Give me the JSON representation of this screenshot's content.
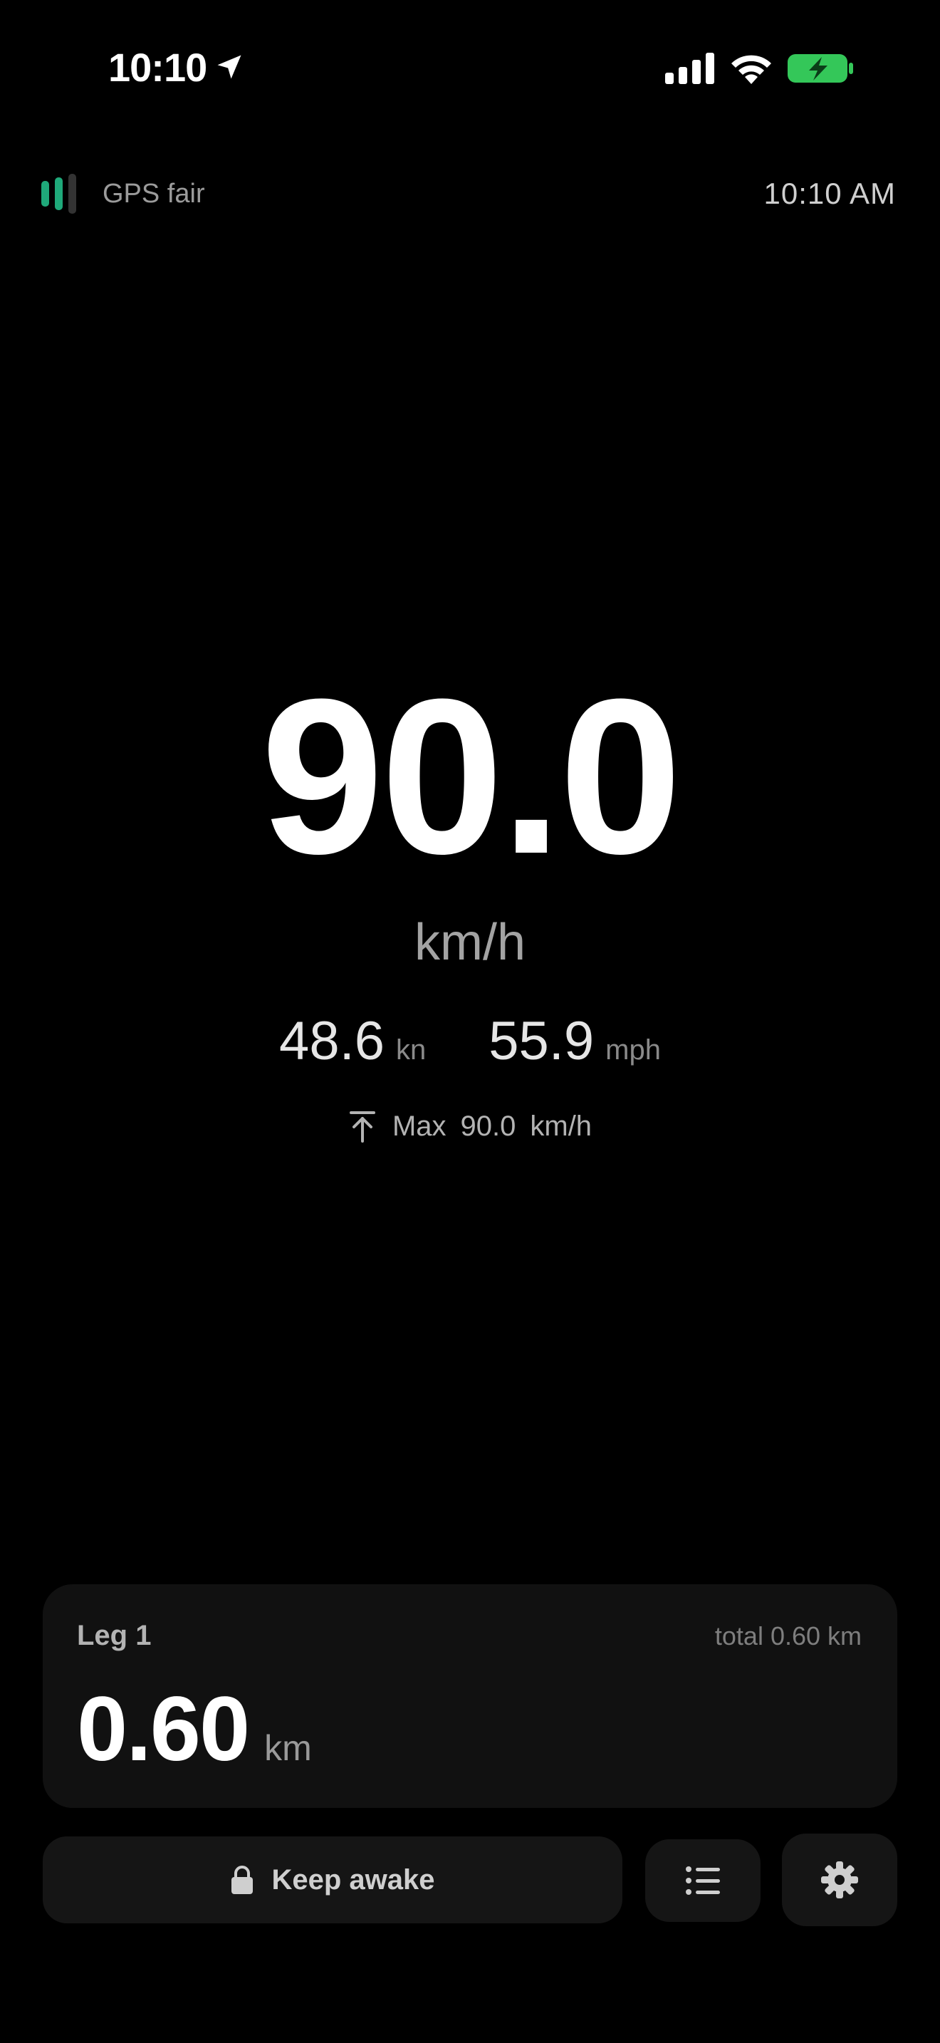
{
  "status_bar": {
    "time": "10:10",
    "icons": [
      "location-arrow-icon",
      "cellular-signal-icon",
      "wifi-icon",
      "battery-charging-icon"
    ],
    "battery_color": "#34c759"
  },
  "header": {
    "gps_label": "GPS fair",
    "gps_bars_active": 2,
    "gps_bars_total": 3,
    "gps_color": "#1fa97a",
    "clock": "10:10 AM"
  },
  "speed": {
    "value": "90.0",
    "unit": "km/h",
    "knots_value": "48.6",
    "knots_unit": "kn",
    "mph_value": "55.9",
    "mph_unit": "mph",
    "max_label": "Max",
    "max_value": "90.0",
    "max_unit": "km/h"
  },
  "leg": {
    "title": "Leg 1",
    "total": "total 0.60 km",
    "distance": "0.60",
    "unit": "km"
  },
  "actions": {
    "keep_awake_label": "Keep awake",
    "icons": [
      "lock-icon",
      "list-icon",
      "gear-icon"
    ]
  }
}
